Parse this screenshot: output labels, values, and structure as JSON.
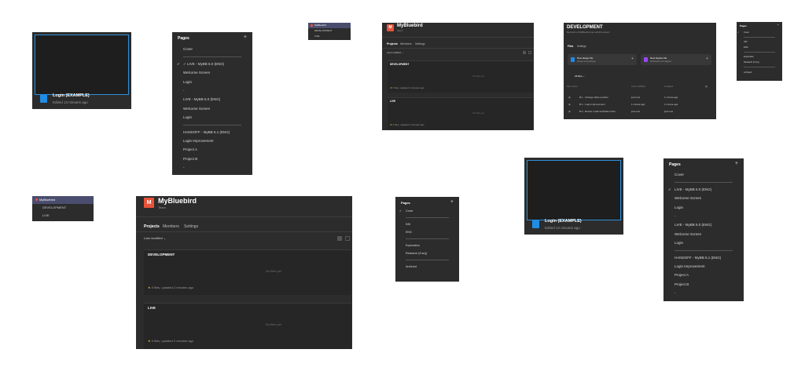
{
  "file_card": {
    "name": "Login (EXAMPLE)",
    "edited": "Edited 13 minutes ago"
  },
  "pages_large": {
    "title": "Pages",
    "add": "+",
    "items": [
      {
        "label": "Cover"
      },
      {
        "sep": true
      },
      {
        "label": "✓  LIVE - MyBB 6.0 (ENG)",
        "checked": true
      },
      {
        "label": "Welcome Screen"
      },
      {
        "label": "Login"
      },
      {
        "label": "-"
      },
      {
        "label": "LIVE - MyBB 6.0 (ENG)"
      },
      {
        "label": "Welcome Screen"
      },
      {
        "label": "Login"
      },
      {
        "sep": true
      },
      {
        "label": "HANDOFF - MyBB 6.1 (ENG)"
      },
      {
        "label": "Login Improvement"
      },
      {
        "label": "Project A"
      },
      {
        "label": "Project B"
      },
      {
        "label": "-"
      }
    ]
  },
  "pages_right": {
    "title": "Pages",
    "add": "+",
    "items": [
      {
        "label": "Cover"
      },
      {
        "sep": true
      },
      {
        "label": "LIVE - MyBB 6.0 (ENG)",
        "checked": true
      },
      {
        "label": "Welcome Screen"
      },
      {
        "label": "Login"
      },
      {
        "label": "-"
      },
      {
        "label": "LIVE - MyBB 6.0 (ENG)"
      },
      {
        "label": "Welcome Screen"
      },
      {
        "label": "Login"
      },
      {
        "sep": true
      },
      {
        "label": "HANDOFF - MyBB 6.1 (ENG)"
      },
      {
        "label": "Login Improvement"
      },
      {
        "label": "Project A"
      },
      {
        "label": "Project B"
      },
      {
        "label": "-"
      }
    ]
  },
  "pages_small": {
    "title": "Pages",
    "add": "+",
    "items": [
      {
        "label": "Cover",
        "checked": true
      },
      {
        "sep": true
      },
      {
        "label": "IND"
      },
      {
        "label": "ENG"
      },
      {
        "sep": true
      },
      {
        "label": "Exploration"
      },
      {
        "label": "Research (if any)"
      },
      {
        "sep": true
      },
      {
        "label": "Archived"
      }
    ]
  },
  "pages_tiny": {
    "title": "Pages",
    "add": "+",
    "items": [
      {
        "label": "Cover",
        "checked": true
      },
      {
        "sep": true
      },
      {
        "label": "IND"
      },
      {
        "label": "ENG"
      },
      {
        "sep": true
      },
      {
        "label": "Exploration"
      },
      {
        "label": "Research (if any)"
      },
      {
        "sep": true
      },
      {
        "label": "Archived"
      }
    ]
  },
  "team_dropdown": {
    "items": [
      "MyBluebird",
      "DEVELOPMENT",
      "LIVE"
    ]
  },
  "team_page": {
    "avatar": "M",
    "name": "MyBluebird",
    "subtitle": "Team",
    "tabs": [
      "Projects",
      "Members",
      "Settings"
    ],
    "sort": "Last modified ⌄",
    "projects": [
      {
        "title": "DEVELOPMENT",
        "empty": "No files yet",
        "footer": "0 files, updated 2 minutes ago"
      },
      {
        "title": "LIVE",
        "empty": "No files yet",
        "footer": "0 files, updated 2 minutes ago"
      }
    ]
  },
  "project_page": {
    "title": "DEVELOPMENT",
    "subtitle": "Members of MyBluebird can edit this project",
    "tabs": [
      "Files",
      "Settings"
    ],
    "create": [
      {
        "label": "New design file",
        "sub": "Design and prototype",
        "color": "#1f8ce6"
      },
      {
        "label": "New FigJam file",
        "sub": "Whiteboard and diagram",
        "color": "#9747ff"
      }
    ],
    "filter": "All files ⌄",
    "columns": [
      "File name ↑",
      "Last modified",
      "Created"
    ],
    "rows": [
      {
        "name": "B.1 - Change slider position",
        "modified": "just now",
        "created": "1 minute ago"
      },
      {
        "name": "B.1 - Login improvement",
        "modified": "1 minute ago",
        "created": "1 minute ago"
      },
      {
        "name": "B.2 - Revise email verification flow",
        "modified": "just now",
        "created": "just now"
      }
    ]
  }
}
